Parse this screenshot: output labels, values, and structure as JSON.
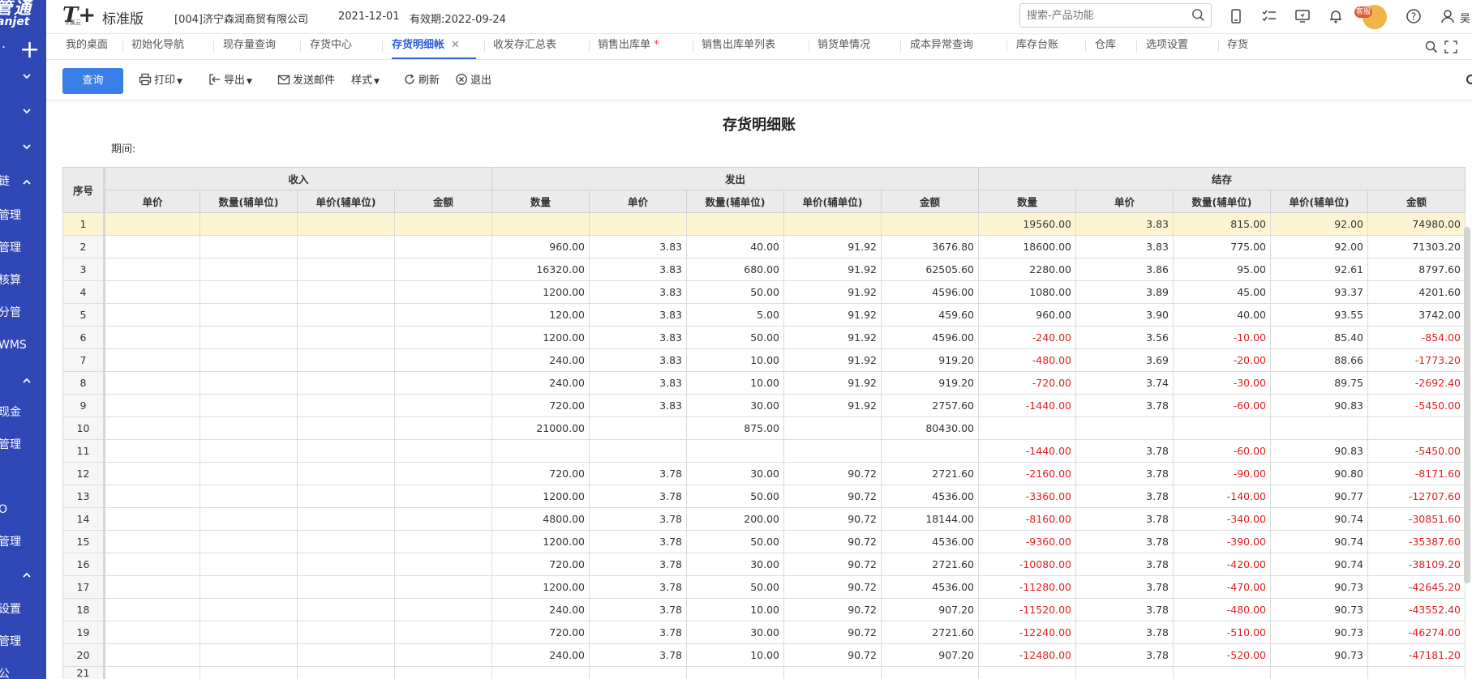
{
  "sidebar": {
    "logo_line1": "管通",
    "logo_line2": "anjet",
    "rows": [
      {
        "text": "",
        "chev": "down"
      },
      {
        "text": "",
        "chev": "down"
      },
      {
        "text": "",
        "chev": "down"
      },
      {
        "text": "链",
        "chev": "up"
      },
      {
        "text": "管理",
        "chev": ""
      },
      {
        "text": "管理",
        "chev": ""
      },
      {
        "text": "核算",
        "chev": ""
      },
      {
        "text": "分管",
        "chev": ""
      },
      {
        "text": "WMS",
        "chev": ""
      },
      {
        "text": "",
        "chev": "up"
      },
      {
        "text": "现金",
        "chev": ""
      },
      {
        "text": "管理",
        "chev": ""
      },
      {
        "text": "",
        "chev": ""
      },
      {
        "text": "O",
        "chev": ""
      },
      {
        "text": "管理",
        "chev": ""
      },
      {
        "text": "",
        "chev": "up"
      },
      {
        "text": "设置",
        "chev": ""
      },
      {
        "text": "管理",
        "chev": ""
      },
      {
        "text": "公",
        "chev": ""
      }
    ]
  },
  "header": {
    "brand_logo": "T+",
    "brand_sub": "专属云",
    "edition": "标准版",
    "company": "[004]济宁森润商贸有限公司",
    "date": "2021-12-01",
    "valid": "有效期:2022-09-24",
    "search_placeholder": "搜索-产品功能",
    "kefu_label": "客服",
    "user_initial": "吴"
  },
  "tabs": [
    {
      "label": "我的桌面",
      "active": false,
      "star": false
    },
    {
      "label": "初始化导航",
      "active": false,
      "star": false
    },
    {
      "label": "现存量查询",
      "active": false,
      "star": false
    },
    {
      "label": "存货中心",
      "active": false,
      "star": false
    },
    {
      "label": "存货明细帐",
      "active": true,
      "star": false
    },
    {
      "label": "收发存汇总表",
      "active": false,
      "star": false
    },
    {
      "label": "销售出库单",
      "active": false,
      "star": true
    },
    {
      "label": "销售出库单列表",
      "active": false,
      "star": false
    },
    {
      "label": "销货单情况",
      "active": false,
      "star": false
    },
    {
      "label": "成本异常查询",
      "active": false,
      "star": false
    },
    {
      "label": "库存台账",
      "active": false,
      "star": false
    },
    {
      "label": "仓库",
      "active": false,
      "star": false
    },
    {
      "label": "选项设置",
      "active": false,
      "star": false
    },
    {
      "label": "存货",
      "active": false,
      "star": false
    }
  ],
  "toolbar": {
    "query": "查询",
    "print": "打印",
    "export": "导出",
    "email": "发送邮件",
    "style": "样式",
    "refresh": "刷新",
    "exit": "退出"
  },
  "report": {
    "title": "存货明细账",
    "period_label": "期间:"
  },
  "table": {
    "seq_header": "序号",
    "groups": [
      "收入",
      "发出",
      "结存"
    ],
    "in_cols": [
      "单价",
      "数量(辅单位)",
      "单价(辅单位)",
      "金额"
    ],
    "out_cols": [
      "数量",
      "单价",
      "数量(辅单位)",
      "单价(辅单位)",
      "金额"
    ],
    "bal_cols": [
      "数量",
      "单价",
      "数量(辅单位)",
      "单价(辅单位)",
      "金额"
    ],
    "rows": [
      [
        "1",
        "",
        "",
        "",
        "",
        "",
        "",
        "",
        "",
        "",
        "19560.00",
        "3.83",
        "815.00",
        "92.00",
        "74980.00"
      ],
      [
        "2",
        "",
        "",
        "",
        "",
        "960.00",
        "3.83",
        "40.00",
        "91.92",
        "3676.80",
        "18600.00",
        "3.83",
        "775.00",
        "92.00",
        "71303.20"
      ],
      [
        "3",
        "",
        "",
        "",
        "",
        "16320.00",
        "3.83",
        "680.00",
        "91.92",
        "62505.60",
        "2280.00",
        "3.86",
        "95.00",
        "92.61",
        "8797.60"
      ],
      [
        "4",
        "",
        "",
        "",
        "",
        "1200.00",
        "3.83",
        "50.00",
        "91.92",
        "4596.00",
        "1080.00",
        "3.89",
        "45.00",
        "93.37",
        "4201.60"
      ],
      [
        "5",
        "",
        "",
        "",
        "",
        "120.00",
        "3.83",
        "5.00",
        "91.92",
        "459.60",
        "960.00",
        "3.90",
        "40.00",
        "93.55",
        "3742.00"
      ],
      [
        "6",
        "",
        "",
        "",
        "",
        "1200.00",
        "3.83",
        "50.00",
        "91.92",
        "4596.00",
        "-240.00",
        "3.56",
        "-10.00",
        "85.40",
        "-854.00"
      ],
      [
        "7",
        "",
        "",
        "",
        "",
        "240.00",
        "3.83",
        "10.00",
        "91.92",
        "919.20",
        "-480.00",
        "3.69",
        "-20.00",
        "88.66",
        "-1773.20"
      ],
      [
        "8",
        "",
        "",
        "",
        "",
        "240.00",
        "3.83",
        "10.00",
        "91.92",
        "919.20",
        "-720.00",
        "3.74",
        "-30.00",
        "89.75",
        "-2692.40"
      ],
      [
        "9",
        "",
        "",
        "",
        "",
        "720.00",
        "3.83",
        "30.00",
        "91.92",
        "2757.60",
        "-1440.00",
        "3.78",
        "-60.00",
        "90.83",
        "-5450.00"
      ],
      [
        "10",
        "",
        "",
        "",
        "",
        "21000.00",
        "",
        "875.00",
        "",
        "80430.00",
        "",
        "",
        "",
        "",
        ""
      ],
      [
        "11",
        "",
        "",
        "",
        "",
        "",
        "",
        "",
        "",
        "",
        "-1440.00",
        "3.78",
        "-60.00",
        "90.83",
        "-5450.00"
      ],
      [
        "12",
        "",
        "",
        "",
        "",
        "720.00",
        "3.78",
        "30.00",
        "90.72",
        "2721.60",
        "-2160.00",
        "3.78",
        "-90.00",
        "90.80",
        "-8171.60"
      ],
      [
        "13",
        "",
        "",
        "",
        "",
        "1200.00",
        "3.78",
        "50.00",
        "90.72",
        "4536.00",
        "-3360.00",
        "3.78",
        "-140.00",
        "90.77",
        "-12707.60"
      ],
      [
        "14",
        "",
        "",
        "",
        "",
        "4800.00",
        "3.78",
        "200.00",
        "90.72",
        "18144.00",
        "-8160.00",
        "3.78",
        "-340.00",
        "90.74",
        "-30851.60"
      ],
      [
        "15",
        "",
        "",
        "",
        "",
        "1200.00",
        "3.78",
        "50.00",
        "90.72",
        "4536.00",
        "-9360.00",
        "3.78",
        "-390.00",
        "90.74",
        "-35387.60"
      ],
      [
        "16",
        "",
        "",
        "",
        "",
        "720.00",
        "3.78",
        "30.00",
        "90.72",
        "2721.60",
        "-10080.00",
        "3.78",
        "-420.00",
        "90.74",
        "-38109.20"
      ],
      [
        "17",
        "",
        "",
        "",
        "",
        "1200.00",
        "3.78",
        "50.00",
        "90.72",
        "4536.00",
        "-11280.00",
        "3.78",
        "-470.00",
        "90.73",
        "-42645.20"
      ],
      [
        "18",
        "",
        "",
        "",
        "",
        "240.00",
        "3.78",
        "10.00",
        "90.72",
        "907.20",
        "-11520.00",
        "3.78",
        "-480.00",
        "90.73",
        "-43552.40"
      ],
      [
        "19",
        "",
        "",
        "",
        "",
        "720.00",
        "3.78",
        "30.00",
        "90.72",
        "2721.60",
        "-12240.00",
        "3.78",
        "-510.00",
        "90.73",
        "-46274.00"
      ],
      [
        "20",
        "",
        "",
        "",
        "",
        "240.00",
        "3.78",
        "10.00",
        "90.72",
        "907.20",
        "-12480.00",
        "3.78",
        "-520.00",
        "90.73",
        "-47181.20"
      ],
      [
        "21",
        "",
        "",
        "",
        "",
        "",
        "",
        "",
        "",
        "",
        "",
        "",
        "",
        "",
        ""
      ]
    ]
  },
  "colors": {
    "sidebar": "#2f48b5",
    "accent": "#3a7ee8",
    "active_tab": "#2f5fd6",
    "negative": "#e02020",
    "highlight_row": "#fdf5d2"
  }
}
